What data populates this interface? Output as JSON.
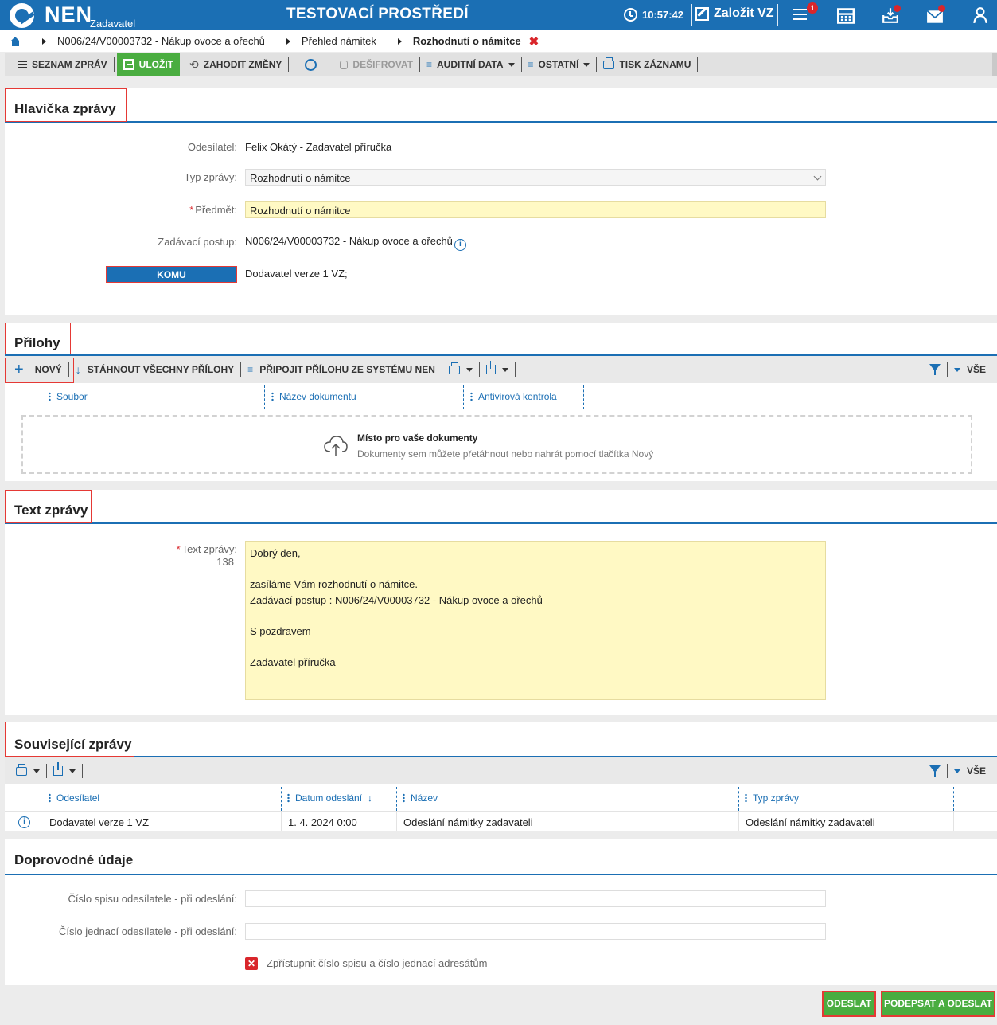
{
  "topbar": {
    "logo_text": "NEN",
    "logo_sub": "Zadavatel",
    "env_title": "TESTOVACÍ PROSTŘEDÍ",
    "time": "10:57:42",
    "create_label": "Založit VZ",
    "menu_badge": "1"
  },
  "breadcrumb": {
    "items": [
      "N006/24/V00003732 - Nákup ovoce a ořechů",
      "Přehled námitek",
      "Rozhodnutí o námitce"
    ],
    "close": "✖"
  },
  "toolbar": {
    "message_list": "SEZNAM ZPRÁV",
    "save": "ULOŽIT",
    "discard": "ZAHODIT ZMĚNY",
    "decrypt": "DEŠIFROVAT",
    "audit": "AUDITNÍ DATA",
    "other": "OSTATNÍ",
    "print": "TISK ZÁZNAMU"
  },
  "header_section": {
    "title": "Hlavička zprávy",
    "sender_label": "Odesílatel:",
    "sender_value": "Felix Okátý - Zadavatel příručka",
    "type_label": "Typ zprávy:",
    "type_value": "Rozhodnutí o námitce",
    "subject_label": "Předmět:",
    "subject_value": "Rozhodnutí o námitce",
    "procedure_label": "Zadávací postup:",
    "procedure_value": "N006/24/V00003732 - Nákup ovoce a ořechů",
    "to_button": "KOMU",
    "to_value": "Dodavatel verze 1 VZ;"
  },
  "attachments": {
    "title": "Přílohy",
    "new": "NOVÝ",
    "download_all": "STÁHNOUT VŠECHNY PŘÍLOHY",
    "attach_from_system": "PŘIPOJIT PŘÍLOHU ZE SYSTÉMU NEN",
    "all": "VŠE",
    "columns": [
      "Soubor",
      "Název dokumentu",
      "Antivirová kontrola"
    ],
    "drop_title": "Místo pro vaše dokumenty",
    "drop_sub": "Dokumenty sem můžete přetáhnout nebo nahrát pomocí tlačítka Nový"
  },
  "message_text": {
    "title": "Text zprávy",
    "label": "Text zprávy:",
    "char_count": "138",
    "body": "Dobrý den,\n\nzasíláme Vám rozhodnutí o námitce.\nZadávací postup : N006/24/V00003732 - Nákup ovoce a ořechů\n\nS pozdravem\n\nZadavatel příručka"
  },
  "related": {
    "title": "Související zprávy",
    "all": "VŠE",
    "columns": [
      "Odesílatel",
      "Datum odeslání",
      "Název",
      "Typ zprávy"
    ],
    "rows": [
      {
        "sender": "Dodavatel verze 1 VZ",
        "date": "1. 4. 2024 0:00",
        "name": "Odeslání námitky zadavateli",
        "type": "Odeslání námitky zadavateli"
      }
    ]
  },
  "accompanying": {
    "title": "Doprovodné údaje",
    "file_no_label": "Číslo spisu odesílatele - při odeslání:",
    "ref_no_label": "Číslo jednací odesílatele - při odeslání:",
    "checkbox_label": "Zpřístupnit číslo spisu a číslo jednací adresátům"
  },
  "footer": {
    "send": "ODESLAT",
    "sign_send": "PODEPSAT A ODESLAT"
  },
  "colors": {
    "brand_blue": "#1b6fb4",
    "success_green": "#4aad40",
    "required_red": "#d9262b",
    "highlight_yellow": "#fff9c4"
  }
}
